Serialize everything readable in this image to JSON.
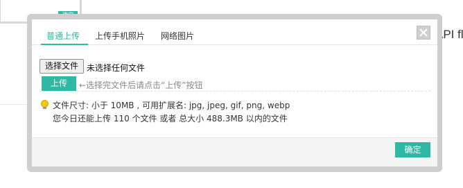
{
  "background": {
    "confirm_label": "确定",
    "right_text": "API fla"
  },
  "dialog": {
    "tabs": [
      {
        "label": "普通上传",
        "active": true
      },
      {
        "label": "上传手机照片",
        "active": false
      },
      {
        "label": "网络图片",
        "active": false
      }
    ],
    "file_button": "选择文件",
    "file_status": "未选择任何文件",
    "upload_button": "上传",
    "upload_hint": "←选择完文件后请点击“上传”按钮",
    "info_line1": "文件尺寸: 小于 10MB , 可用扩展名: jpg, jpeg, gif, png, webp",
    "info_line2": "您今日还能上传 110 个文件 或者 总大小 488.3MB 以内的文件",
    "ok_button": "确定"
  },
  "colors": {
    "accent": "#2fb8a3",
    "frame": "#cfcfcf"
  }
}
